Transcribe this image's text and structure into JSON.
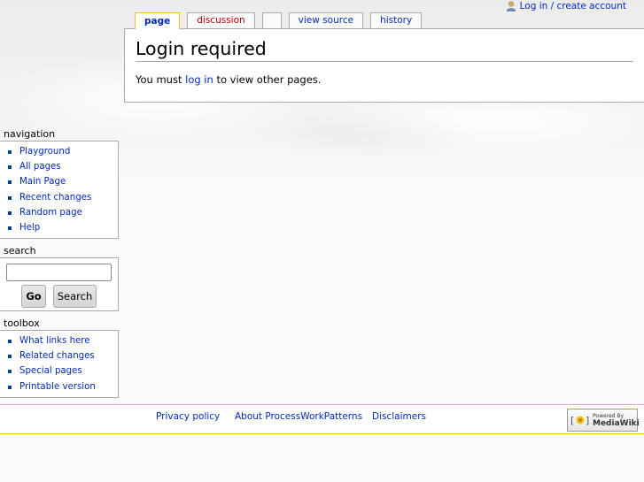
{
  "personal_tools": {
    "login_label": "Log in / create account"
  },
  "tabs": [
    {
      "label": "page",
      "selected": true
    },
    {
      "label": "discussion",
      "selected": false
    },
    {
      "label": "",
      "selected": false
    },
    {
      "label": "view source",
      "selected": false
    },
    {
      "label": "history",
      "selected": false
    }
  ],
  "content": {
    "title": "Login required",
    "message_before": "You must ",
    "message_link": "log in",
    "message_after": " to view other pages."
  },
  "navigation": {
    "heading": "navigation",
    "items": [
      "Playground",
      "All pages",
      "Main Page",
      "Recent changes",
      "Random page",
      "Help"
    ]
  },
  "search": {
    "heading": "search",
    "value": "",
    "go_label": "Go",
    "search_label": "Search"
  },
  "toolbox": {
    "heading": "toolbox",
    "items": [
      "What links here",
      "Related changes",
      "Special pages",
      "Printable version"
    ]
  },
  "footer": {
    "links": [
      "Privacy policy",
      "About ProcessWorkPatterns",
      "Disclaimers"
    ],
    "powered_by_line1": "Powered By",
    "powered_by_line2": "MediaWiki"
  },
  "colors": {
    "link": "#002bb8",
    "new_link": "#ba0000",
    "accent_border": "#fabd23",
    "bullet": "#00408f"
  },
  "icons": {
    "user": "user-icon",
    "mediawiki": "mediawiki-flower-icon"
  }
}
